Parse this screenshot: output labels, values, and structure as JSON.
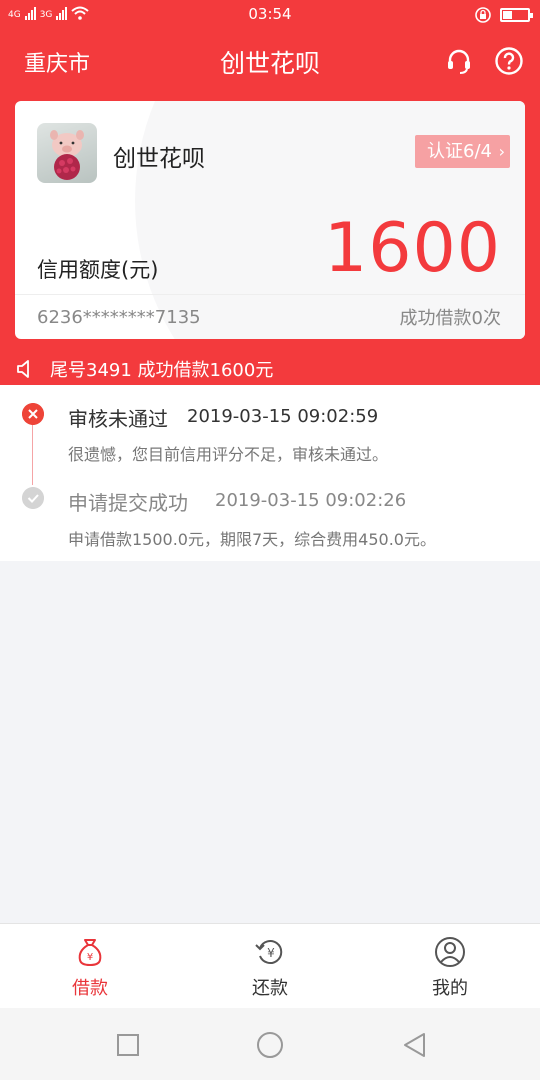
{
  "status_bar": {
    "time": "03:54",
    "net1": "4G",
    "net2": "3G"
  },
  "header": {
    "city": "重庆市",
    "title": "创世花呗"
  },
  "card": {
    "name": "创世花呗",
    "cert_badge": "认证6/4",
    "credit_label": "信用额度(元)",
    "credit_amount": "1600",
    "card_number": "6236********7135",
    "success_count": "成功借款0次"
  },
  "notice": {
    "text": "尾号3491 成功借款1600元"
  },
  "timeline": [
    {
      "title": "审核未通过",
      "time": "2019-03-15 09:02:59",
      "desc": "很遗憾，您目前信用评分不足，审核未通过。"
    },
    {
      "title": "申请提交成功",
      "time": "2019-03-15 09:02:26",
      "desc": "申请借款1500.0元，期限7天，综合费用450.0元。"
    }
  ],
  "tabs": [
    {
      "label": "借款",
      "icon": "money-bag-icon"
    },
    {
      "label": "还款",
      "icon": "refund-icon"
    },
    {
      "label": "我的",
      "icon": "profile-icon"
    }
  ],
  "colors": {
    "brand": "#f33a3d",
    "tab_active": "#e9353a"
  }
}
